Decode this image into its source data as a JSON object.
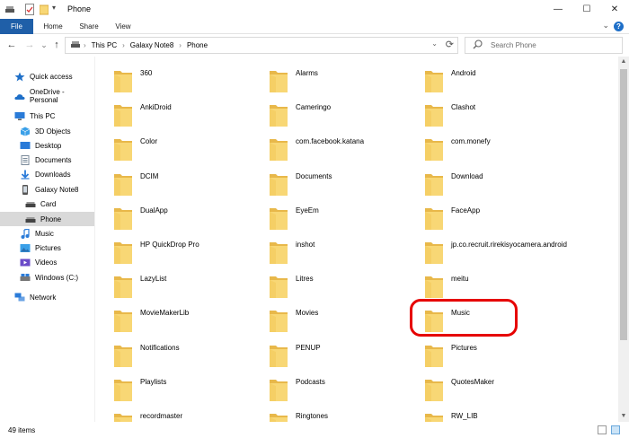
{
  "window": {
    "title": "Phone",
    "minimize_glyph": "—",
    "maximize_glyph": "☐",
    "close_glyph": "✕"
  },
  "ribbon": {
    "tabs": [
      "File",
      "Home",
      "Share",
      "View"
    ],
    "collapse_glyph": "⌄",
    "help_glyph": "?"
  },
  "address": {
    "back_glyph": "←",
    "forward_glyph": "→",
    "recent_glyph": "⌄",
    "up_glyph": "↑",
    "crumbs": [
      "This PC",
      "Galaxy Note8",
      "Phone"
    ],
    "crumb_separator": "›",
    "dropdown_glyph": "⌄",
    "refresh_glyph": "⟳"
  },
  "search": {
    "placeholder": "Search Phone",
    "icon_glyph": "⌕"
  },
  "nav": {
    "items": [
      {
        "label": "Quick access",
        "icon": "star-icon",
        "color": "#1e6fc8"
      },
      {
        "label": "OneDrive - Personal",
        "icon": "cloud-icon",
        "color": "#1e6fc8"
      },
      {
        "label": "This PC",
        "icon": "computer-icon",
        "color": "#2a7bd8"
      },
      {
        "label": "3D Objects",
        "icon": "cube-icon",
        "color": "#3aa0e8"
      },
      {
        "label": "Desktop",
        "icon": "desktop-icon",
        "color": "#2a7bd8"
      },
      {
        "label": "Documents",
        "icon": "document-icon",
        "color": "#7a8a9a"
      },
      {
        "label": "Downloads",
        "icon": "download-icon",
        "color": "#2a7bd8"
      },
      {
        "label": "Galaxy Note8",
        "icon": "phone-icon",
        "color": "#555555"
      },
      {
        "label": "Card",
        "icon": "drive-icon",
        "color": "#444444"
      },
      {
        "label": "Phone",
        "icon": "drive-icon",
        "color": "#444444"
      },
      {
        "label": "Music",
        "icon": "music-icon",
        "color": "#2a7bd8"
      },
      {
        "label": "Pictures",
        "icon": "pictures-icon",
        "color": "#3aa0e8"
      },
      {
        "label": "Videos",
        "icon": "videos-icon",
        "color": "#6a4bc8"
      },
      {
        "label": "Windows (C:)",
        "icon": "disk-icon",
        "color": "#2a7bd8"
      },
      {
        "label": "Network",
        "icon": "network-icon",
        "color": "#2a7bd8"
      }
    ],
    "selected": "Phone"
  },
  "folders": [
    "360",
    "Alarms",
    "Android",
    "AnkiDroid",
    "Cameringo",
    "Clashot",
    "Color",
    "com.facebook.katana",
    "com.monefy",
    "DCIM",
    "Documents",
    "Download",
    "DualApp",
    "EyeEm",
    "FaceApp",
    "HP QuickDrop Pro",
    "inshot",
    "jp.co.recruit.rirekisyocamera.android",
    "LazyList",
    "Litres",
    "meitu",
    "MovieMakerLib",
    "Movies",
    "Music",
    "Notifications",
    "PENUP",
    "Pictures",
    "Playlists",
    "Podcasts",
    "QuotesMaker",
    "recordmaster",
    "Ringtones",
    "RW_LIB"
  ],
  "highlighted_folder": "Music",
  "colors": {
    "folder_fill": "#f8d775",
    "folder_back": "#e8b84a",
    "file_tab": "#1f5fa8",
    "highlight": "#e60000",
    "selected_nav": "#d9d9d9"
  },
  "status": {
    "item_count": "49 items"
  }
}
